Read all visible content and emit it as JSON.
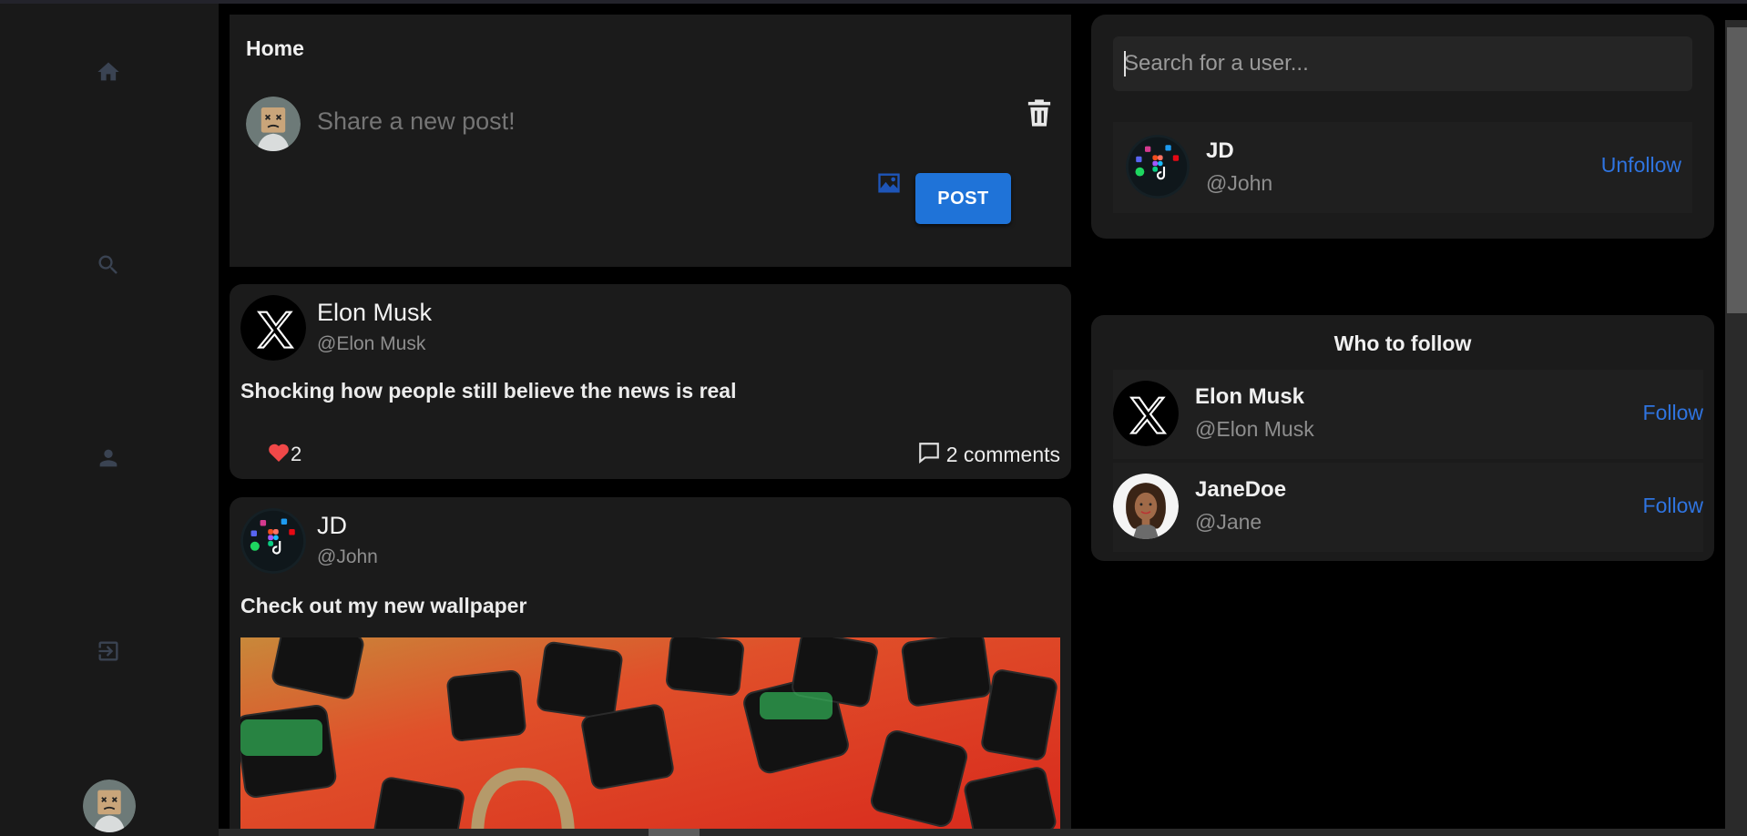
{
  "nav": {
    "items": [
      {
        "name": "home",
        "icon": "home-icon"
      },
      {
        "name": "search",
        "icon": "search-icon"
      },
      {
        "name": "profile",
        "icon": "user-icon"
      },
      {
        "name": "logout",
        "icon": "logout-icon"
      }
    ],
    "avatar_icon": "avatar-dead-face"
  },
  "composer": {
    "title": "Home",
    "placeholder": "Share a new post!",
    "post_label": "POST"
  },
  "posts": [
    {
      "name": "Elon Musk",
      "handle": "@Elon Musk",
      "text": "Shocking how people still believe the news is real",
      "likes": "2",
      "comments": "2 comments",
      "avatar": "x-logo"
    },
    {
      "name": "JD",
      "handle": "@John",
      "text": "Check out my new wallpaper",
      "avatar": "app-icons",
      "image": "red-keyboard-keys-padlock"
    }
  ],
  "search": {
    "placeholder": "Search for a user...",
    "result": {
      "name": "JD",
      "handle": "@John",
      "action": "Unfollow"
    }
  },
  "who_to_follow": {
    "title": "Who to follow",
    "users": [
      {
        "name": "Elon Musk",
        "handle": "@Elon Musk",
        "action": "Follow"
      },
      {
        "name": "JaneDoe",
        "handle": "@Jane",
        "action": "Follow"
      }
    ]
  },
  "colors": {
    "accent": "#1f73d8",
    "link": "#2f74e0",
    "like": "#f04848",
    "panel": "#1b1b1b",
    "sidebar": "#191919"
  }
}
